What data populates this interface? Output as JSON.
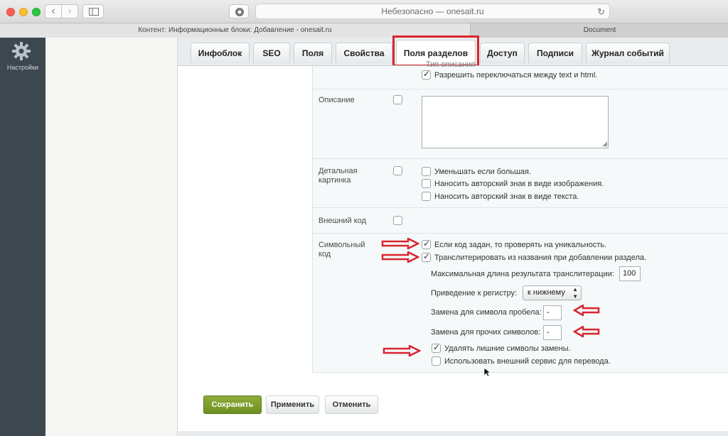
{
  "browser": {
    "address": "Небезопасно — onesait.ru",
    "tabs": [
      {
        "label": "Контент: Информационные блоки: Добавление - onesait.ru"
      },
      {
        "label": "Document"
      }
    ]
  },
  "sidebar": {
    "settings_label": "Настройки"
  },
  "content_tabs": [
    {
      "label": "Инфоблок"
    },
    {
      "label": "SEO"
    },
    {
      "label": "Поля"
    },
    {
      "label": "Свойства"
    },
    {
      "label": "Поля разделов"
    },
    {
      "label": "Доступ"
    },
    {
      "label": "Подписи"
    },
    {
      "label": "Журнал событий"
    }
  ],
  "form": {
    "cut_label": "Тип описания",
    "allow_switch": "Разрешить переключаться между text и html.",
    "description_label": "Описание",
    "detail_label": "Детальная картинка",
    "detail_options": [
      "Уменьшать если большая.",
      "Наносить авторский знак в виде изображения.",
      "Наносить авторский знак в виде текста."
    ],
    "external_code_label": "Внешний код",
    "symbol_code_label": "Символьный код",
    "symbol_options": [
      "Если код задан, то проверять на уникальность.",
      "Транслитерировать из названия при добавлении раздела."
    ],
    "max_length_label": "Максимальная длина результата транслитерации:",
    "max_length_value": "100",
    "case_label": "Приведение к регистру:",
    "case_value": "к нижнему",
    "space_label": "Замена для символа пробела:",
    "space_value": "-",
    "other_label": "Замена для прочих символов:",
    "other_value": "-",
    "remove_extra": "Удалять лишние символы замены.",
    "use_external": "Использовать внешний сервис для перевода."
  },
  "buttons": {
    "save": "Сохранить",
    "apply": "Применить",
    "cancel": "Отменить"
  },
  "colors": {
    "accent": "#d9252e",
    "save_button": "#7a9a2a"
  }
}
